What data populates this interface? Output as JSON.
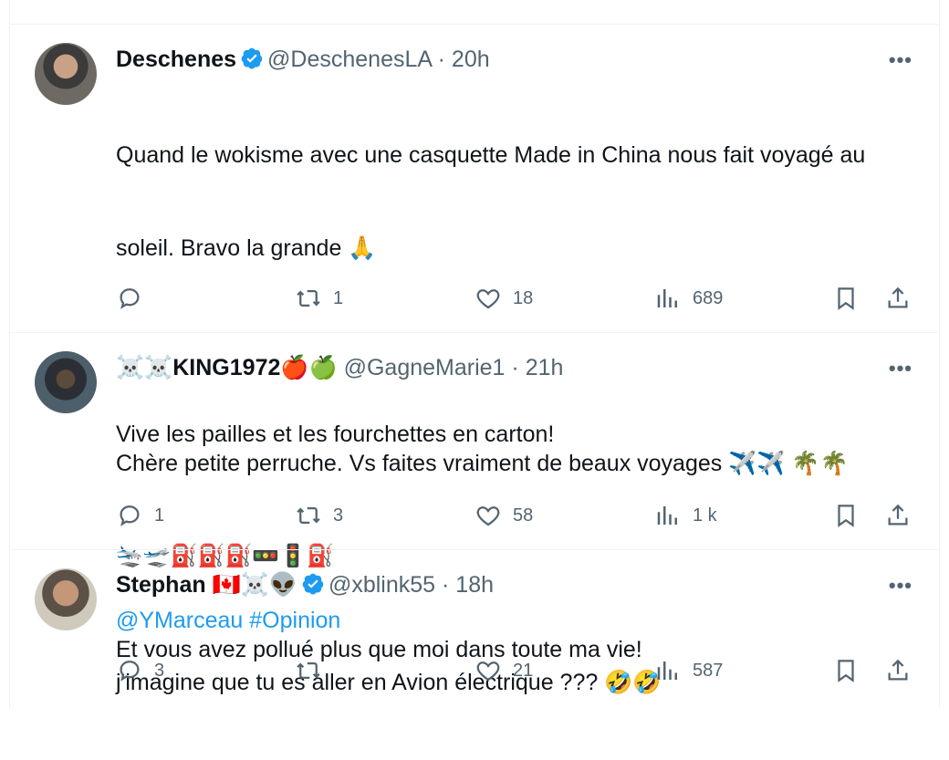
{
  "tweets": [
    {
      "name": "Deschenes",
      "handle": "@DeschenesLA",
      "time": "20h",
      "verified": true,
      "body_line1": "Quand le wokisme avec une casquette Made in China nous fait voyagé au",
      "body_line2": "soleil. Bravo la grande 🙏",
      "body_line3": "Vive les pailles et les fourchettes en carton!",
      "mentions": "@YMarceau #Opinion",
      "replies": "",
      "retweets": "1",
      "likes": "18",
      "views": "689"
    },
    {
      "name": "☠️☠️KING1972🍎🍏",
      "handle": "@GagneMarie1",
      "time": "21h",
      "verified": false,
      "body_line1": "Chère petite perruche. Vs faites vraiment de beaux voyages ✈️✈️ 🌴🌴",
      "body_line2": "🛬🛫⛽⛽⛽🚥🚦⛽",
      "body_line3": "Et vous avez pollué plus que moi dans toute ma vie!",
      "replies": "1",
      "retweets": "3",
      "likes": "58",
      "views": "1 k"
    },
    {
      "name": "Stephan 🇨🇦☠️👽",
      "handle": "@xblink55",
      "time": "18h",
      "verified": true,
      "body_line1": "j'imagine que tu es aller en Avion électrique ??? 🤣🤣",
      "replies": "3",
      "retweets": "",
      "likes": "21",
      "views": "587"
    }
  ],
  "ui": {
    "more": "•••",
    "sep": "·"
  },
  "colors": {
    "accent": "#1d9bf0",
    "muted": "#536471",
    "text": "#0f1419"
  }
}
